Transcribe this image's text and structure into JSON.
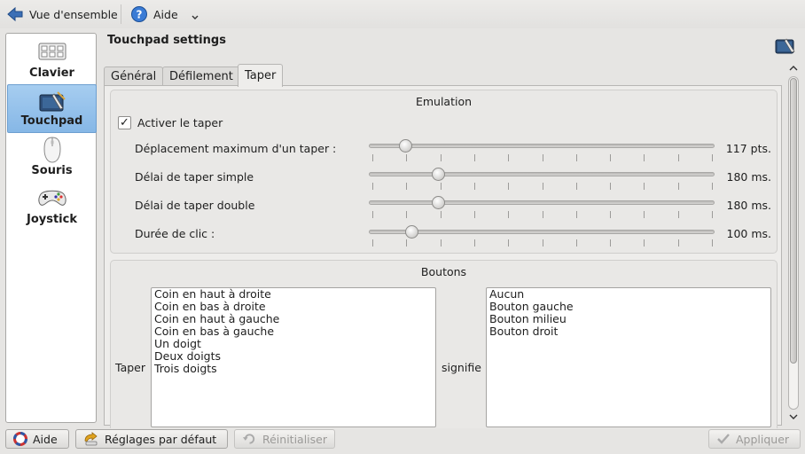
{
  "toolbar": {
    "overview_label": "Vue d'ensemble",
    "help_label": "Aide"
  },
  "categories": [
    {
      "label": "Clavier",
      "icon": "keyboard-icon"
    },
    {
      "label": "Touchpad",
      "icon": "touchpad-icon",
      "selected": true
    },
    {
      "label": "Souris",
      "icon": "mouse-icon"
    },
    {
      "label": "Joystick",
      "icon": "joystick-icon"
    }
  ],
  "page_title": "Touchpad settings",
  "tabs": [
    {
      "label": "Général"
    },
    {
      "label": "Défilement"
    },
    {
      "label": "Taper",
      "active": true
    }
  ],
  "emulation": {
    "title": "Emulation",
    "enable_tap_label": "Activer le taper",
    "enable_tap_checked": true,
    "sliders": [
      {
        "label": "Déplacement maximum d'un taper :",
        "value_text": "117 pts.",
        "fraction": 0.09
      },
      {
        "label": "Délai de taper simple",
        "value_text": "180 ms.",
        "fraction": 0.19
      },
      {
        "label": "Délai de taper double",
        "value_text": "180 ms.",
        "fraction": 0.19
      },
      {
        "label": "Durée de clic :",
        "value_text": "100 ms.",
        "fraction": 0.11
      }
    ]
  },
  "buttons_group": {
    "title": "Boutons",
    "tap_label": "Taper",
    "means_label": "signifie",
    "tap_items": [
      "Coin en haut à droite",
      "Coin en bas à droite",
      "Coin en haut à gauche",
      "Coin en bas à gauche",
      "Un doigt",
      "Deux doigts",
      "Trois doigts"
    ],
    "action_items": [
      "Aucun",
      "Bouton gauche",
      "Bouton milieu",
      "Bouton droit"
    ]
  },
  "footer": {
    "help": "Aide",
    "defaults": "Réglages par défaut",
    "reset": "Réinitialiser",
    "apply": "Appliquer"
  },
  "colors": {
    "selection": "#86b7e6",
    "window_bg": "#e6e5e3"
  }
}
